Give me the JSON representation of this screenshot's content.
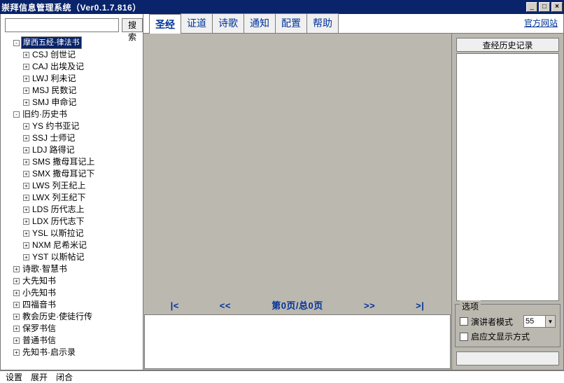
{
  "title": "崇拜信息管理系统（Ver0.1.7.816）",
  "official_site": "官方网站",
  "search": {
    "placeholder": "",
    "button": "搜索"
  },
  "tree": [
    {
      "level": 1,
      "exp": "-",
      "label": "摩西五经·律法书",
      "selected": true
    },
    {
      "level": 2,
      "exp": "+",
      "label": "CSJ 创世记"
    },
    {
      "level": 2,
      "exp": "+",
      "label": "CAJ 出埃及记"
    },
    {
      "level": 2,
      "exp": "+",
      "label": "LWJ 利未记"
    },
    {
      "level": 2,
      "exp": "+",
      "label": "MSJ 民数记"
    },
    {
      "level": 2,
      "exp": "+",
      "label": "SMJ 申命记"
    },
    {
      "level": 1,
      "exp": "-",
      "label": "旧约·历史书"
    },
    {
      "level": 2,
      "exp": "+",
      "label": "YS 约书亚记"
    },
    {
      "level": 2,
      "exp": "+",
      "label": "SSJ 士师记"
    },
    {
      "level": 2,
      "exp": "+",
      "label": "LDJ 路得记"
    },
    {
      "level": 2,
      "exp": "+",
      "label": "SMS 撒母耳记上"
    },
    {
      "level": 2,
      "exp": "+",
      "label": "SMX 撒母耳记下"
    },
    {
      "level": 2,
      "exp": "+",
      "label": "LWS 列王纪上"
    },
    {
      "level": 2,
      "exp": "+",
      "label": "LWX 列王纪下"
    },
    {
      "level": 2,
      "exp": "+",
      "label": "LDS 历代志上"
    },
    {
      "level": 2,
      "exp": "+",
      "label": "LDX 历代志下"
    },
    {
      "level": 2,
      "exp": "+",
      "label": "YSL 以斯拉记"
    },
    {
      "level": 2,
      "exp": "+",
      "label": "NXM 尼希米记"
    },
    {
      "level": 2,
      "exp": "+",
      "label": "YST 以斯帖记"
    },
    {
      "level": 1,
      "exp": "+",
      "label": "诗歌·智慧书"
    },
    {
      "level": 1,
      "exp": "+",
      "label": "大先知书"
    },
    {
      "level": 1,
      "exp": "+",
      "label": "小先知书"
    },
    {
      "level": 1,
      "exp": "+",
      "label": "四福音书"
    },
    {
      "level": 1,
      "exp": "+",
      "label": "教会历史·使徒行传"
    },
    {
      "level": 1,
      "exp": "+",
      "label": "保罗书信"
    },
    {
      "level": 1,
      "exp": "+",
      "label": "普通书信"
    },
    {
      "level": 1,
      "exp": "+",
      "label": "先知书·启示录"
    }
  ],
  "tabs": [
    "圣经",
    "证道",
    "诗歌",
    "通知",
    "配置",
    "帮助"
  ],
  "active_tab": 0,
  "nav": {
    "first": "|<",
    "prev": "<<",
    "info": "第0页/总0页",
    "next": ">>",
    "last": ">|"
  },
  "rightcol": {
    "history_btn": "查经历史记录",
    "group_title": "选项",
    "opt1": "演讲者模式",
    "font_size": "55",
    "opt2": "启应文显示方式"
  },
  "status": {
    "settings": "设置",
    "expand": "展开",
    "collapse": "闭合"
  }
}
